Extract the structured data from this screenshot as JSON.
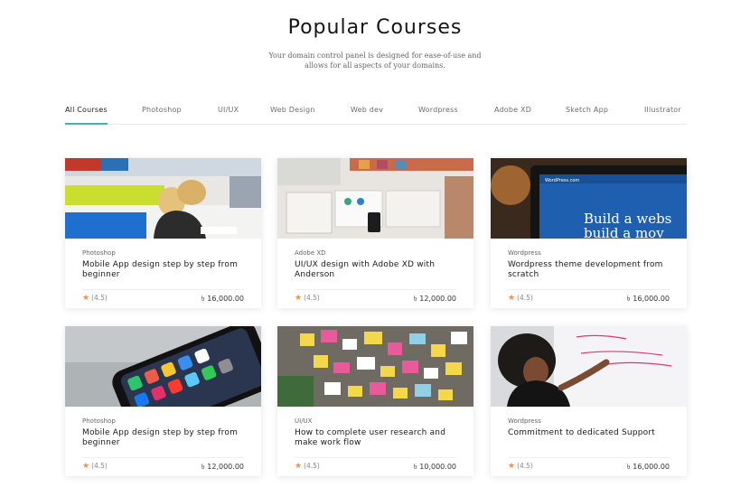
{
  "header": {
    "title": "Popular Courses",
    "subtitle": "Your domain control panel is designed for ease-of-use and allows for all aspects of your domains."
  },
  "tabs": [
    "All Courses",
    "Photoshop",
    "UI/UX",
    "Web Design",
    "Web dev",
    "Wordpress",
    "Adobe XD",
    "Sketch App",
    "Illustrator"
  ],
  "active_tab": "All Courses",
  "courses": [
    {
      "category": "Photoshop",
      "title": "Mobile App design step by step from beginner",
      "rating": "(4.5)",
      "price": "৳ 16,000.00",
      "image": "girl drawing at desk"
    },
    {
      "category": "Adobe XD",
      "title": "UI/UX design with Adobe XD with Anderson",
      "rating": "(4.5)",
      "price": "৳ 12,000.00",
      "image": "design workspace with phone and wireframes"
    },
    {
      "category": "Wordpress",
      "title": "Wordpress theme development from scratch",
      "rating": "(4.5)",
      "price": "৳ 16,000.00",
      "image": "laptop showing WordPress.com",
      "image_text": [
        "Build a webs",
        "build a mov"
      ],
      "image_brand": "WordPress.com"
    },
    {
      "category": "Photoshop",
      "title": "Mobile App design step by step from beginner",
      "rating": "(4.5)",
      "price": "৳ 12,000.00",
      "image": "smartphone home screen"
    },
    {
      "category": "UI/UX",
      "title": "How to complete user research and make work flow",
      "rating": "(4.5)",
      "price": "৳ 10,000.00",
      "image": "wall of sticky notes"
    },
    {
      "category": "Wordpress",
      "title": "Commitment to dedicated Support",
      "rating": "(4.5)",
      "price": "৳ 16,000.00",
      "image": "woman writing on whiteboard"
    }
  ],
  "colors": {
    "accent": "#35b9a8",
    "star": "#f0904a",
    "title": "#161616",
    "muted": "#6d6d6d"
  },
  "icons": {
    "rating": "star-icon"
  }
}
